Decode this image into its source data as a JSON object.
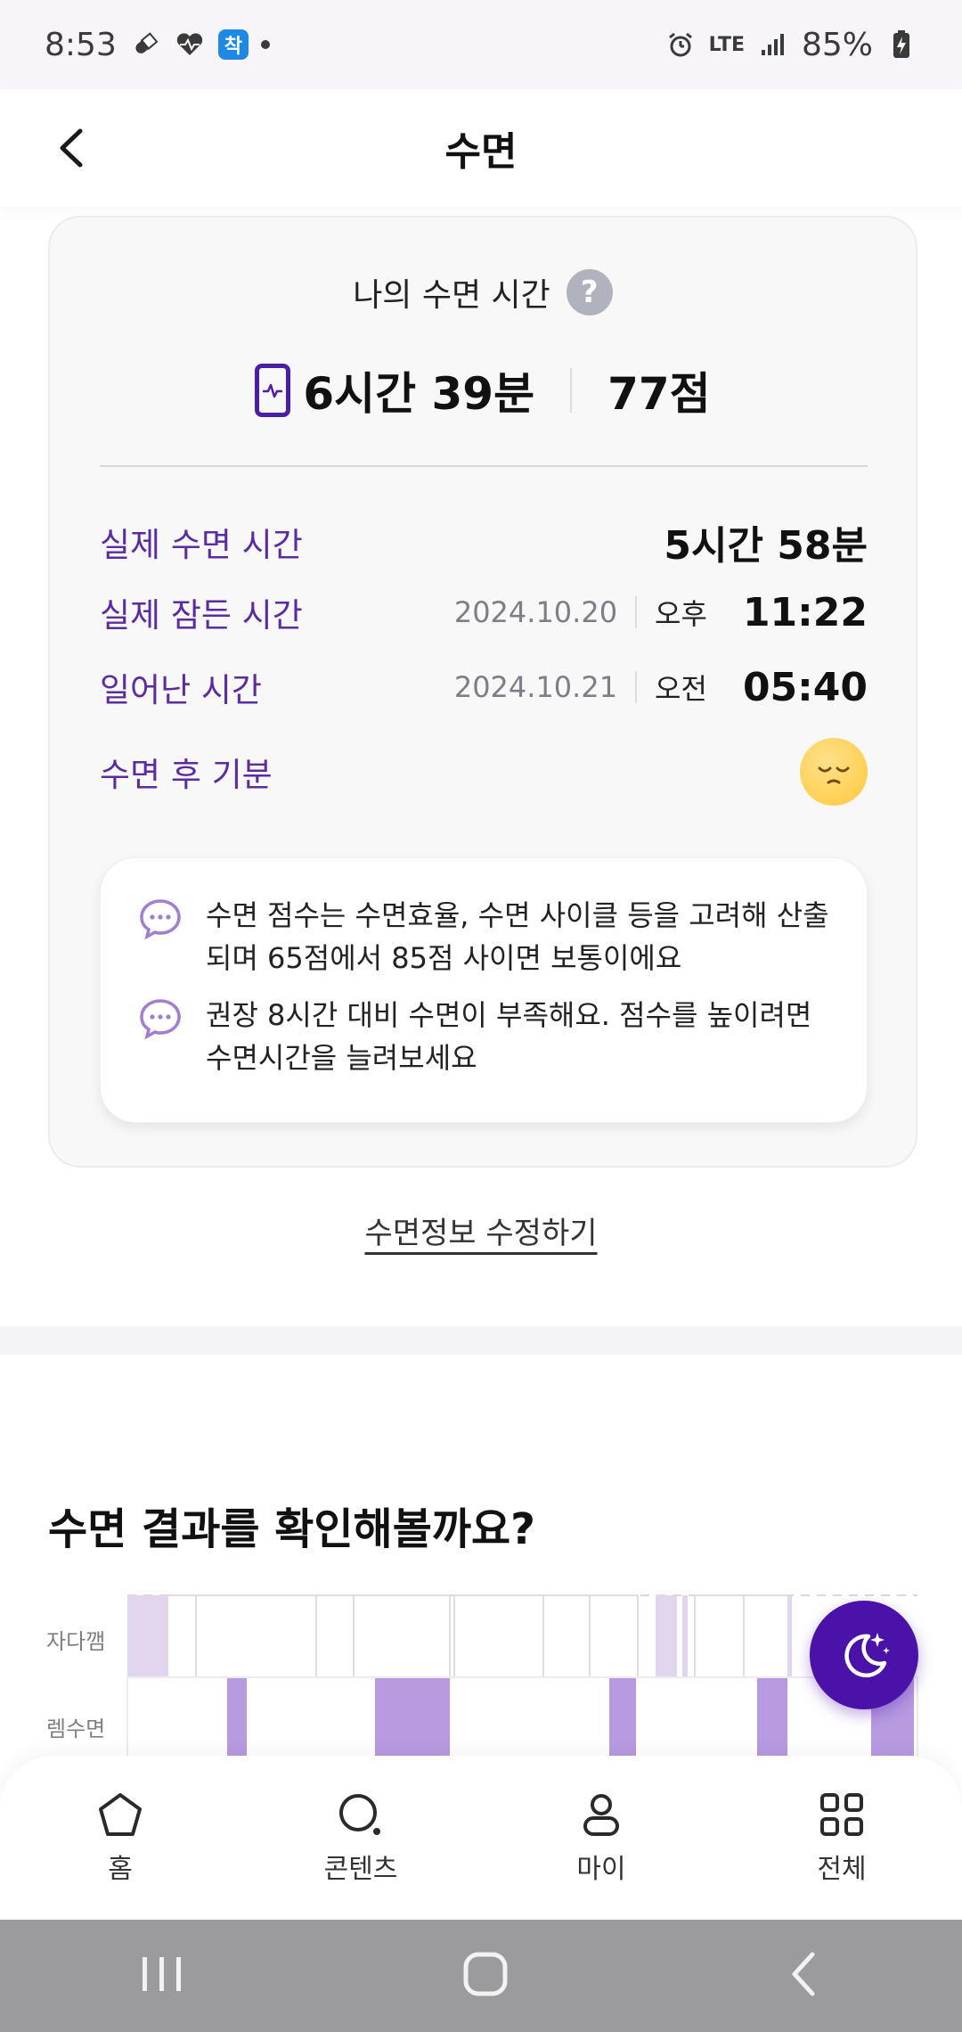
{
  "status_bar": {
    "time": "8:53",
    "app_badge": "착",
    "network": "LTE",
    "battery": "85%"
  },
  "header": {
    "title": "수면"
  },
  "summary_card": {
    "heading": "나의 수면 시간",
    "help": "?",
    "duration": "6시간 39분",
    "score": "77점",
    "rows": [
      {
        "label": "실제 수면 시간",
        "value": "5시간 58분"
      },
      {
        "label": "실제 잠든 시간",
        "date": "2024.10.20",
        "ampm": "오후",
        "time": "11:22"
      },
      {
        "label": "일어난 시간",
        "date": "2024.10.21",
        "ampm": "오전",
        "time": "05:40"
      },
      {
        "label": "수면 후 기분",
        "mood_icon": "sleepy-face-icon"
      }
    ],
    "tips": [
      "수면 점수는 수면효율, 수면 사이클 등을 고려해 산출되며 65점에서 85점 사이면 보통이에요",
      "권장 8시간 대비 수면이 부족해요. 점수를 높이려면 수면시간을 늘려보세요"
    ]
  },
  "edit_link": "수면정보 수정하기",
  "results": {
    "title": "수면 결과를 확인해볼까요?",
    "stage_labels": [
      "자다깸",
      "렘수면"
    ]
  },
  "bottom_nav": [
    {
      "label": "홈",
      "icon": "home-pentagon-icon"
    },
    {
      "label": "콘텐츠",
      "icon": "search-icon"
    },
    {
      "label": "마이",
      "icon": "person-icon"
    },
    {
      "label": "전체",
      "icon": "grid-icon"
    }
  ],
  "colors": {
    "accent": "#4a12a8",
    "label_purple": "#5a2ca0",
    "awake_bar": "#e2d6ee",
    "rem_bar": "#b79ae0"
  }
}
